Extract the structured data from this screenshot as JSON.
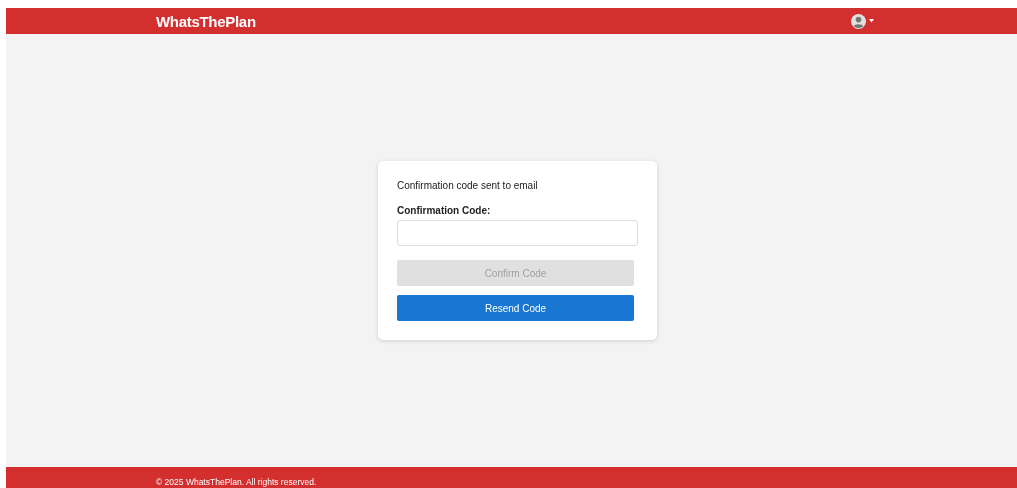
{
  "header": {
    "brand": "WhatsThePlan"
  },
  "card": {
    "message": "Confirmation code sent to email",
    "field": {
      "label": "Confirmation Code:"
    },
    "buttons": [
      {
        "label": "Confirm Code",
        "disabled": true
      },
      {
        "label": "Resend Code",
        "disabled": false
      }
    ]
  },
  "footer": {
    "text": "© 2025 WhatsThePlan. All rights reserved."
  }
}
